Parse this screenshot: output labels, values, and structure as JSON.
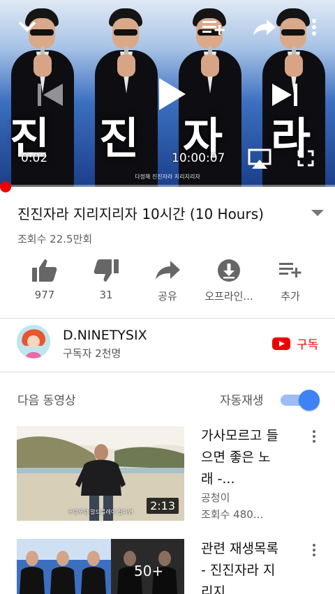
{
  "player": {
    "big_chars": [
      "진",
      "진",
      "자",
      "라"
    ],
    "current_time": "0:02",
    "total_time": "10:00:07",
    "subtitle": "다정해 진진자라 지리지리자",
    "progress_fraction": 0.0003
  },
  "video": {
    "title": "진진자라 지리지리자 10시간 (10 Hours)",
    "views": "조회수 22.5만회"
  },
  "actions": [
    {
      "label": "977",
      "icon": "thumbs-up-icon"
    },
    {
      "label": "31",
      "icon": "thumbs-down-icon"
    },
    {
      "label": "공유",
      "icon": "share-icon"
    },
    {
      "label": "오프라인...",
      "icon": "download-icon"
    },
    {
      "label": "추가",
      "icon": "add-to-playlist-icon"
    }
  ],
  "channel": {
    "name": "D.NINETYSIX",
    "subscribers": "구독자 2천명",
    "subscribe_label": "구독"
  },
  "up_next": {
    "heading": "다음 동영상",
    "autoplay_label": "자동재생",
    "autoplay_on": true,
    "items": [
      {
        "title": "가사모르고 들으면 좋은 노래 -...",
        "channel": "공청이",
        "views": "조회수 480...",
        "duration": "2:13",
        "caption": "우렁우렁 말드를레이 잘다면"
      },
      {
        "title": "관련 재생목록 - 진진자라 지리지...",
        "badge": "50+"
      }
    ]
  },
  "colors": {
    "accent_red": "#ee0000",
    "toggle_blue": "#3e83f5"
  }
}
